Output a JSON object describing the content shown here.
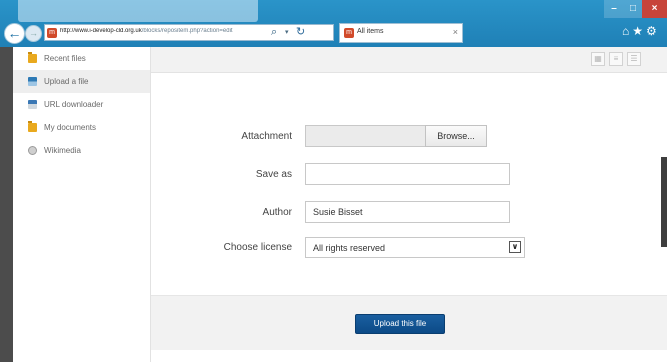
{
  "browser": {
    "url_prefix": "http://www.i-develop-cld.org.uk",
    "url_rest": "/blocks/repositem.php?action=edit",
    "tab_title": "All items",
    "close_glyph": "×",
    "back_glyph": "←",
    "refresh_glyph": "↻",
    "search_glyph": "⌕"
  },
  "sidebar": {
    "items": [
      {
        "label": "Recent files",
        "icon": "folder-icon"
      },
      {
        "label": "Upload a file",
        "icon": "upload-icon"
      },
      {
        "label": "URL downloader",
        "icon": "url-icon"
      },
      {
        "label": "My documents",
        "icon": "folder-icon"
      },
      {
        "label": "Wikimedia",
        "icon": "wikimedia-icon"
      }
    ],
    "selected_index": 1
  },
  "form": {
    "attachment_label": "Attachment",
    "browse_label": "Browse...",
    "saveas_label": "Save as",
    "saveas_value": "",
    "author_label": "Author",
    "author_value": "Susie Bisset",
    "license_label": "Choose license",
    "license_value": "All rights reserved",
    "upload_button": "Upload this file"
  },
  "colors": {
    "chrome_blue": "#1f80b6",
    "upload_button": "#0c4a87",
    "sidebar_selected": "#eeeeee"
  }
}
